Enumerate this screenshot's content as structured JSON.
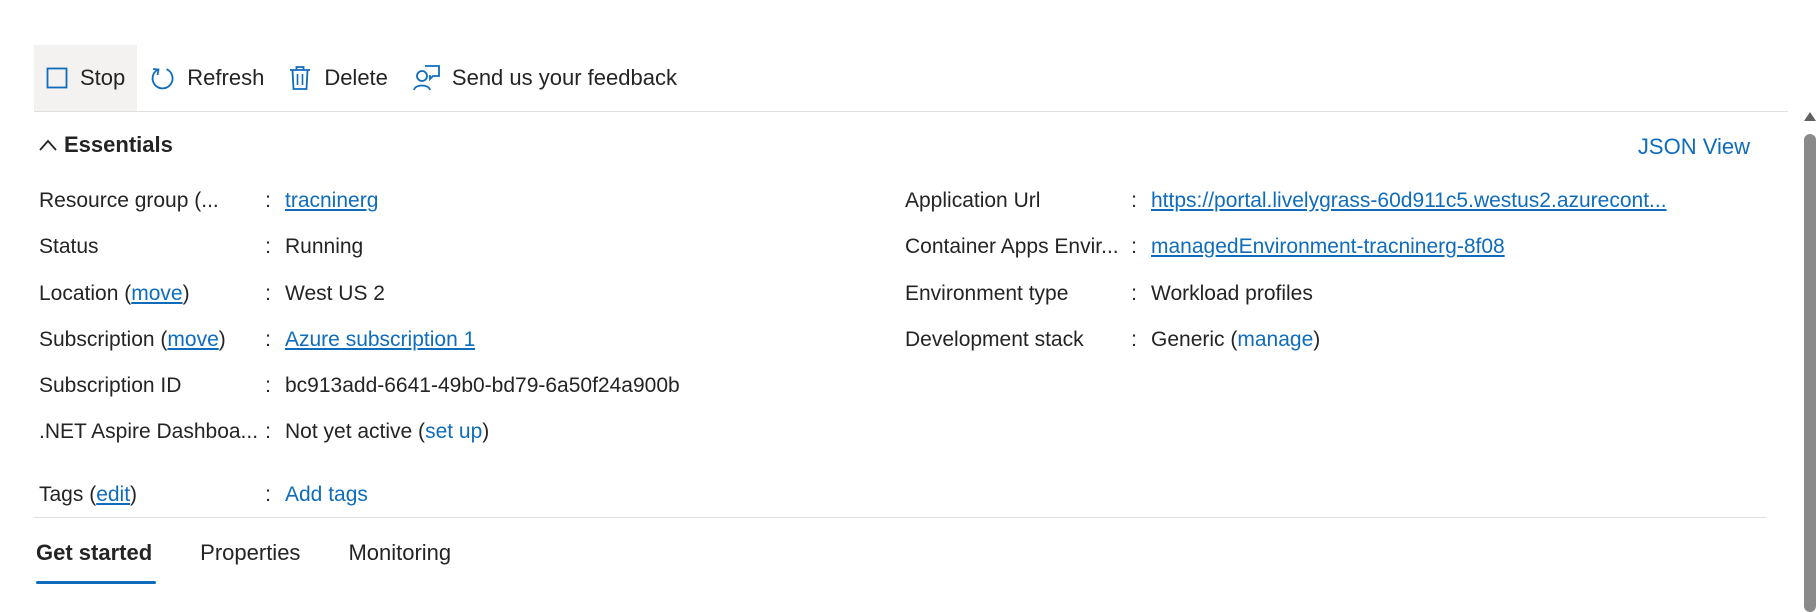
{
  "toolbar": {
    "stop_label": "Stop",
    "refresh_label": "Refresh",
    "delete_label": "Delete",
    "feedback_label": "Send us your feedback"
  },
  "essentials": {
    "title": "Essentials",
    "json_view": "JSON View",
    "left": {
      "resource_group": {
        "label": "Resource group (...",
        "value": "tracninerg"
      },
      "status": {
        "label": "Status",
        "value": "Running"
      },
      "location": {
        "label_prefix": "Location (",
        "label_link": "move",
        "label_suffix": ")",
        "value": "West US 2"
      },
      "subscription": {
        "label_prefix": "Subscription (",
        "label_link": "move",
        "label_suffix": ")",
        "value": "Azure subscription 1"
      },
      "subscription_id": {
        "label": "Subscription ID",
        "value": "bc913add-6641-49b0-bd79-6a50f24a900b"
      },
      "aspire": {
        "label": ".NET Aspire Dashboa...",
        "value_prefix": "Not yet active (",
        "value_link": "set up",
        "value_suffix": ")"
      },
      "tags": {
        "label_prefix": "Tags (",
        "label_link": "edit",
        "label_suffix": ")",
        "value": "Add tags"
      }
    },
    "right": {
      "app_url": {
        "label": "Application Url",
        "value": "https://portal.livelygrass-60d911c5.westus2.azurecont..."
      },
      "container_env": {
        "label": "Container Apps Envir...",
        "value": "managedEnvironment-tracninerg-8f08"
      },
      "env_type": {
        "label": "Environment type",
        "value": "Workload profiles"
      },
      "dev_stack": {
        "label": "Development stack",
        "value_prefix": "Generic (",
        "value_link": "manage",
        "value_suffix": ")"
      }
    },
    "colon": ":"
  },
  "tabs": [
    {
      "label": "Get started",
      "selected": true
    },
    {
      "label": "Properties",
      "selected": false
    },
    {
      "label": "Monitoring",
      "selected": false
    }
  ],
  "colors": {
    "accent": "#0f6cbd",
    "text": "#242424",
    "divider": "#e1dfdd",
    "active_button_bg": "#f3f2f1"
  }
}
